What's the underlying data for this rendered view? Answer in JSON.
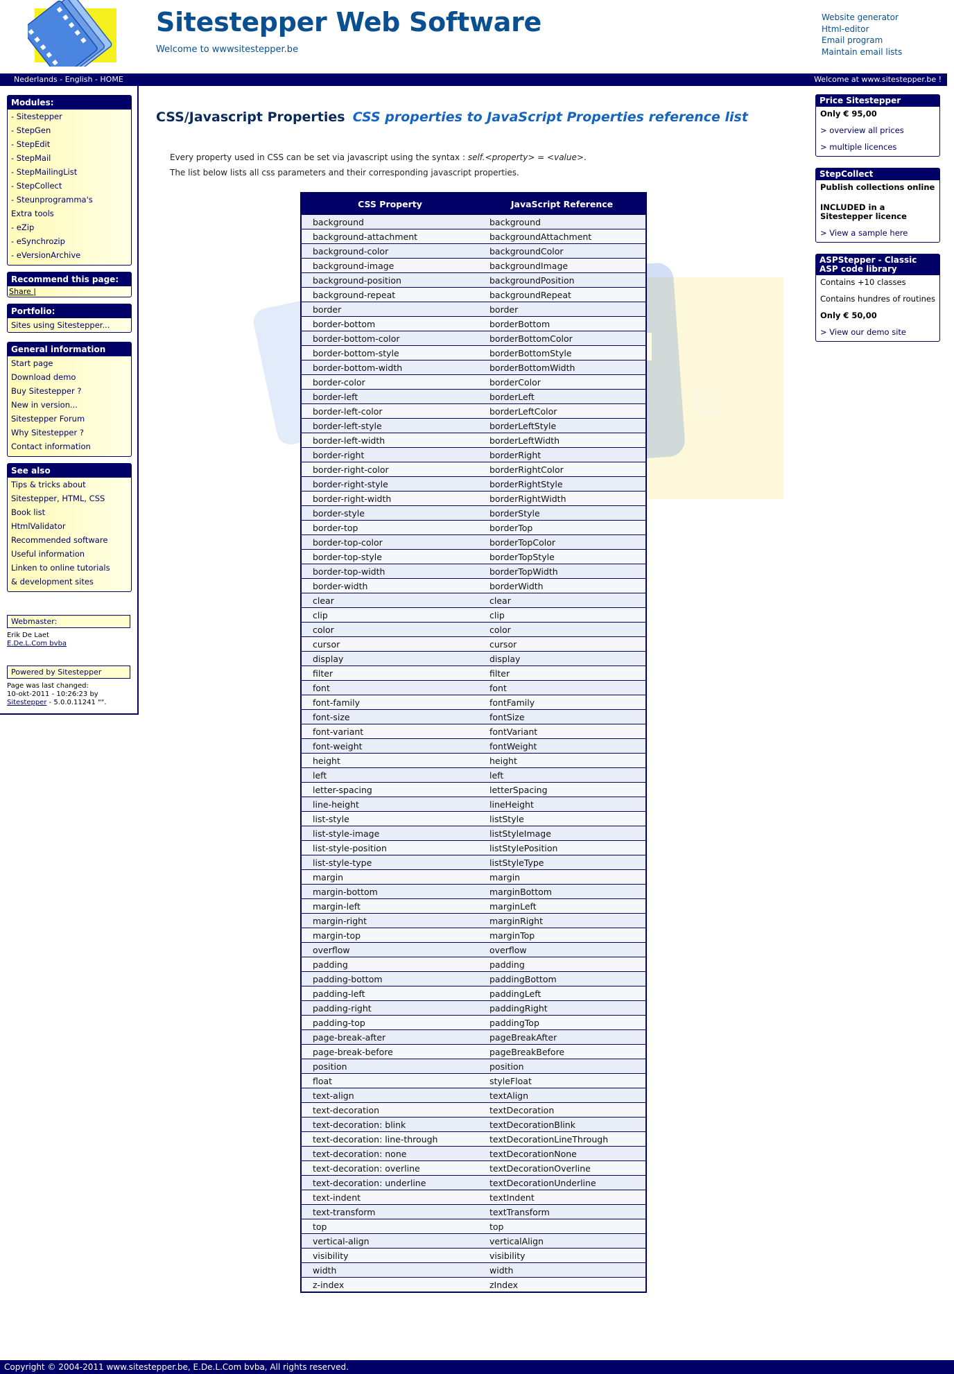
{
  "header": {
    "title": "Sitestepper Web Software",
    "subtitle": "Welcome to wwwsitestepper.be",
    "links": [
      "Website generator",
      "Html-editor",
      "Email program",
      "Maintain email lists"
    ]
  },
  "topbar": {
    "languages": "Nederlands - English - HOME",
    "welcome": "Welcome at www.sitestepper.be !"
  },
  "left": {
    "modules": {
      "title": "Modules:",
      "items": [
        "- Sitestepper",
        "- StepGen",
        "- StepEdit",
        "- StepMail",
        "- StepMailingList",
        "- StepCollect",
        "- Steunprogramma's",
        "Extra tools",
        "- eZip",
        "- eSynchrozip",
        "- eVersionArchive"
      ]
    },
    "recommend": {
      "title": "Recommend this page:",
      "share": "Share |"
    },
    "portfolio": {
      "title": "Portfolio:",
      "items": [
        "Sites using Sitestepper..."
      ]
    },
    "general": {
      "title": "General information",
      "items": [
        "Start page",
        "Download demo",
        "Buy Sitestepper ?",
        "New in version...",
        "Sitestepper Forum",
        "Why Sitestepper ?",
        "Contact information"
      ]
    },
    "seealso": {
      "title": "See also",
      "items": [
        "Tips & tricks about",
        "Sitestepper, HTML, CSS",
        "Book list",
        "HtmlValidator",
        "Recommended software",
        "Useful information",
        "Linken to online tutorials",
        "& development sites"
      ]
    },
    "webmaster_label": "Webmaster:",
    "webmaster_name": "Erik De Laet",
    "webmaster_company": "E.De.L.Com bvba",
    "powered": "Powered by Sitestepper",
    "changed_line1": "Page was last changed:",
    "changed_line2": "10-okt-2011 - 10:26:23 by",
    "changed_link": "Sitestepper",
    "changed_version": " - 5.0.0.11241 \"\"."
  },
  "main": {
    "heading": "CSS/Javascript Properties",
    "heading_sub": "CSS properties to JavaScript Properties reference list",
    "intro_prefix": "Every property used in CSS can be set via javascript using the syntax : ",
    "intro_syntax": "self.<property> = <value>",
    "intro_suffix": ".",
    "intro_line2": "The list below lists all css parameters and their corresponding javascript properties.",
    "table": {
      "headers": [
        "CSS Property",
        "JavaScript Reference"
      ],
      "rows": [
        [
          "background",
          "background"
        ],
        [
          "background-attachment",
          "backgroundAttachment"
        ],
        [
          "background-color",
          "backgroundColor"
        ],
        [
          "background-image",
          "backgroundImage"
        ],
        [
          "background-position",
          "backgroundPosition"
        ],
        [
          "background-repeat",
          "backgroundRepeat"
        ],
        [
          "border",
          "border"
        ],
        [
          "border-bottom",
          "borderBottom"
        ],
        [
          "border-bottom-color",
          "borderBottomColor"
        ],
        [
          "border-bottom-style",
          "borderBottomStyle"
        ],
        [
          "border-bottom-width",
          "borderBottomWidth"
        ],
        [
          "border-color",
          "borderColor"
        ],
        [
          "border-left",
          "borderLeft"
        ],
        [
          "border-left-color",
          "borderLeftColor"
        ],
        [
          "border-left-style",
          "borderLeftStyle"
        ],
        [
          "border-left-width",
          "borderLeftWidth"
        ],
        [
          "border-right",
          "borderRight"
        ],
        [
          "border-right-color",
          "borderRightColor"
        ],
        [
          "border-right-style",
          "borderRightStyle"
        ],
        [
          "border-right-width",
          "borderRightWidth"
        ],
        [
          "border-style",
          "borderStyle"
        ],
        [
          "border-top",
          "borderTop"
        ],
        [
          "border-top-color",
          "borderTopColor"
        ],
        [
          "border-top-style",
          "borderTopStyle"
        ],
        [
          "border-top-width",
          "borderTopWidth"
        ],
        [
          "border-width",
          "borderWidth"
        ],
        [
          "clear",
          "clear"
        ],
        [
          "clip",
          "clip"
        ],
        [
          "color",
          "color"
        ],
        [
          "cursor",
          "cursor"
        ],
        [
          "display",
          "display"
        ],
        [
          "filter",
          "filter"
        ],
        [
          "font",
          "font"
        ],
        [
          "font-family",
          "fontFamily"
        ],
        [
          "font-size",
          "fontSize"
        ],
        [
          "font-variant",
          "fontVariant"
        ],
        [
          "font-weight",
          "fontWeight"
        ],
        [
          "height",
          "height"
        ],
        [
          "left",
          "left"
        ],
        [
          "letter-spacing",
          "letterSpacing"
        ],
        [
          "line-height",
          "lineHeight"
        ],
        [
          "list-style",
          "listStyle"
        ],
        [
          "list-style-image",
          "listStyleImage"
        ],
        [
          "list-style-position",
          "listStylePosition"
        ],
        [
          "list-style-type",
          "listStyleType"
        ],
        [
          "margin",
          "margin"
        ],
        [
          "margin-bottom",
          "marginBottom"
        ],
        [
          "margin-left",
          "marginLeft"
        ],
        [
          "margin-right",
          "marginRight"
        ],
        [
          "margin-top",
          "marginTop"
        ],
        [
          "overflow",
          "overflow"
        ],
        [
          "padding",
          "padding"
        ],
        [
          "padding-bottom",
          "paddingBottom"
        ],
        [
          "padding-left",
          "paddingLeft"
        ],
        [
          "padding-right",
          "paddingRight"
        ],
        [
          "padding-top",
          "paddingTop"
        ],
        [
          "page-break-after",
          "pageBreakAfter"
        ],
        [
          "page-break-before",
          "pageBreakBefore"
        ],
        [
          "position",
          "position"
        ],
        [
          "float",
          "styleFloat"
        ],
        [
          "text-align",
          "textAlign"
        ],
        [
          "text-decoration",
          "textDecoration"
        ],
        [
          "text-decoration: blink",
          "textDecorationBlink"
        ],
        [
          "text-decoration: line-through",
          "textDecorationLineThrough"
        ],
        [
          "text-decoration: none",
          "textDecorationNone"
        ],
        [
          "text-decoration: overline",
          "textDecorationOverline"
        ],
        [
          "text-decoration: underline",
          "textDecorationUnderline"
        ],
        [
          "text-indent",
          "textIndent"
        ],
        [
          "text-transform",
          "textTransform"
        ],
        [
          "top",
          "top"
        ],
        [
          "vertical-align",
          "verticalAlign"
        ],
        [
          "visibility",
          "visibility"
        ],
        [
          "width",
          "width"
        ],
        [
          "z-index",
          "zIndex"
        ]
      ]
    }
  },
  "right": {
    "price": {
      "title": "Price Sitestepper",
      "price": "Only € 95,00",
      "links": [
        "> overview all prices",
        "> multiple licences"
      ]
    },
    "stepcollect": {
      "title": "StepCollect",
      "line1": "Publish collections online",
      "line2": "INCLUDED in a Sitestepper licence",
      "link": "> View a sample here"
    },
    "aspstepper": {
      "title": "ASPStepper - Classic ASP code library",
      "line1": "Contains +10 classes",
      "line2": "Contains hundres of routines",
      "price": "Only € 50,00",
      "link": "> View our demo site"
    }
  },
  "footer": {
    "text": "Copyright © 2004-2011 www.sitestepper.be, E.De.L.Com bvba, All rights reserved."
  },
  "colors": {
    "navy": "#000066",
    "title_blue": "#0a4f8f",
    "box_yellow": "#fffbb8",
    "accent_blue": "#1565c0"
  }
}
